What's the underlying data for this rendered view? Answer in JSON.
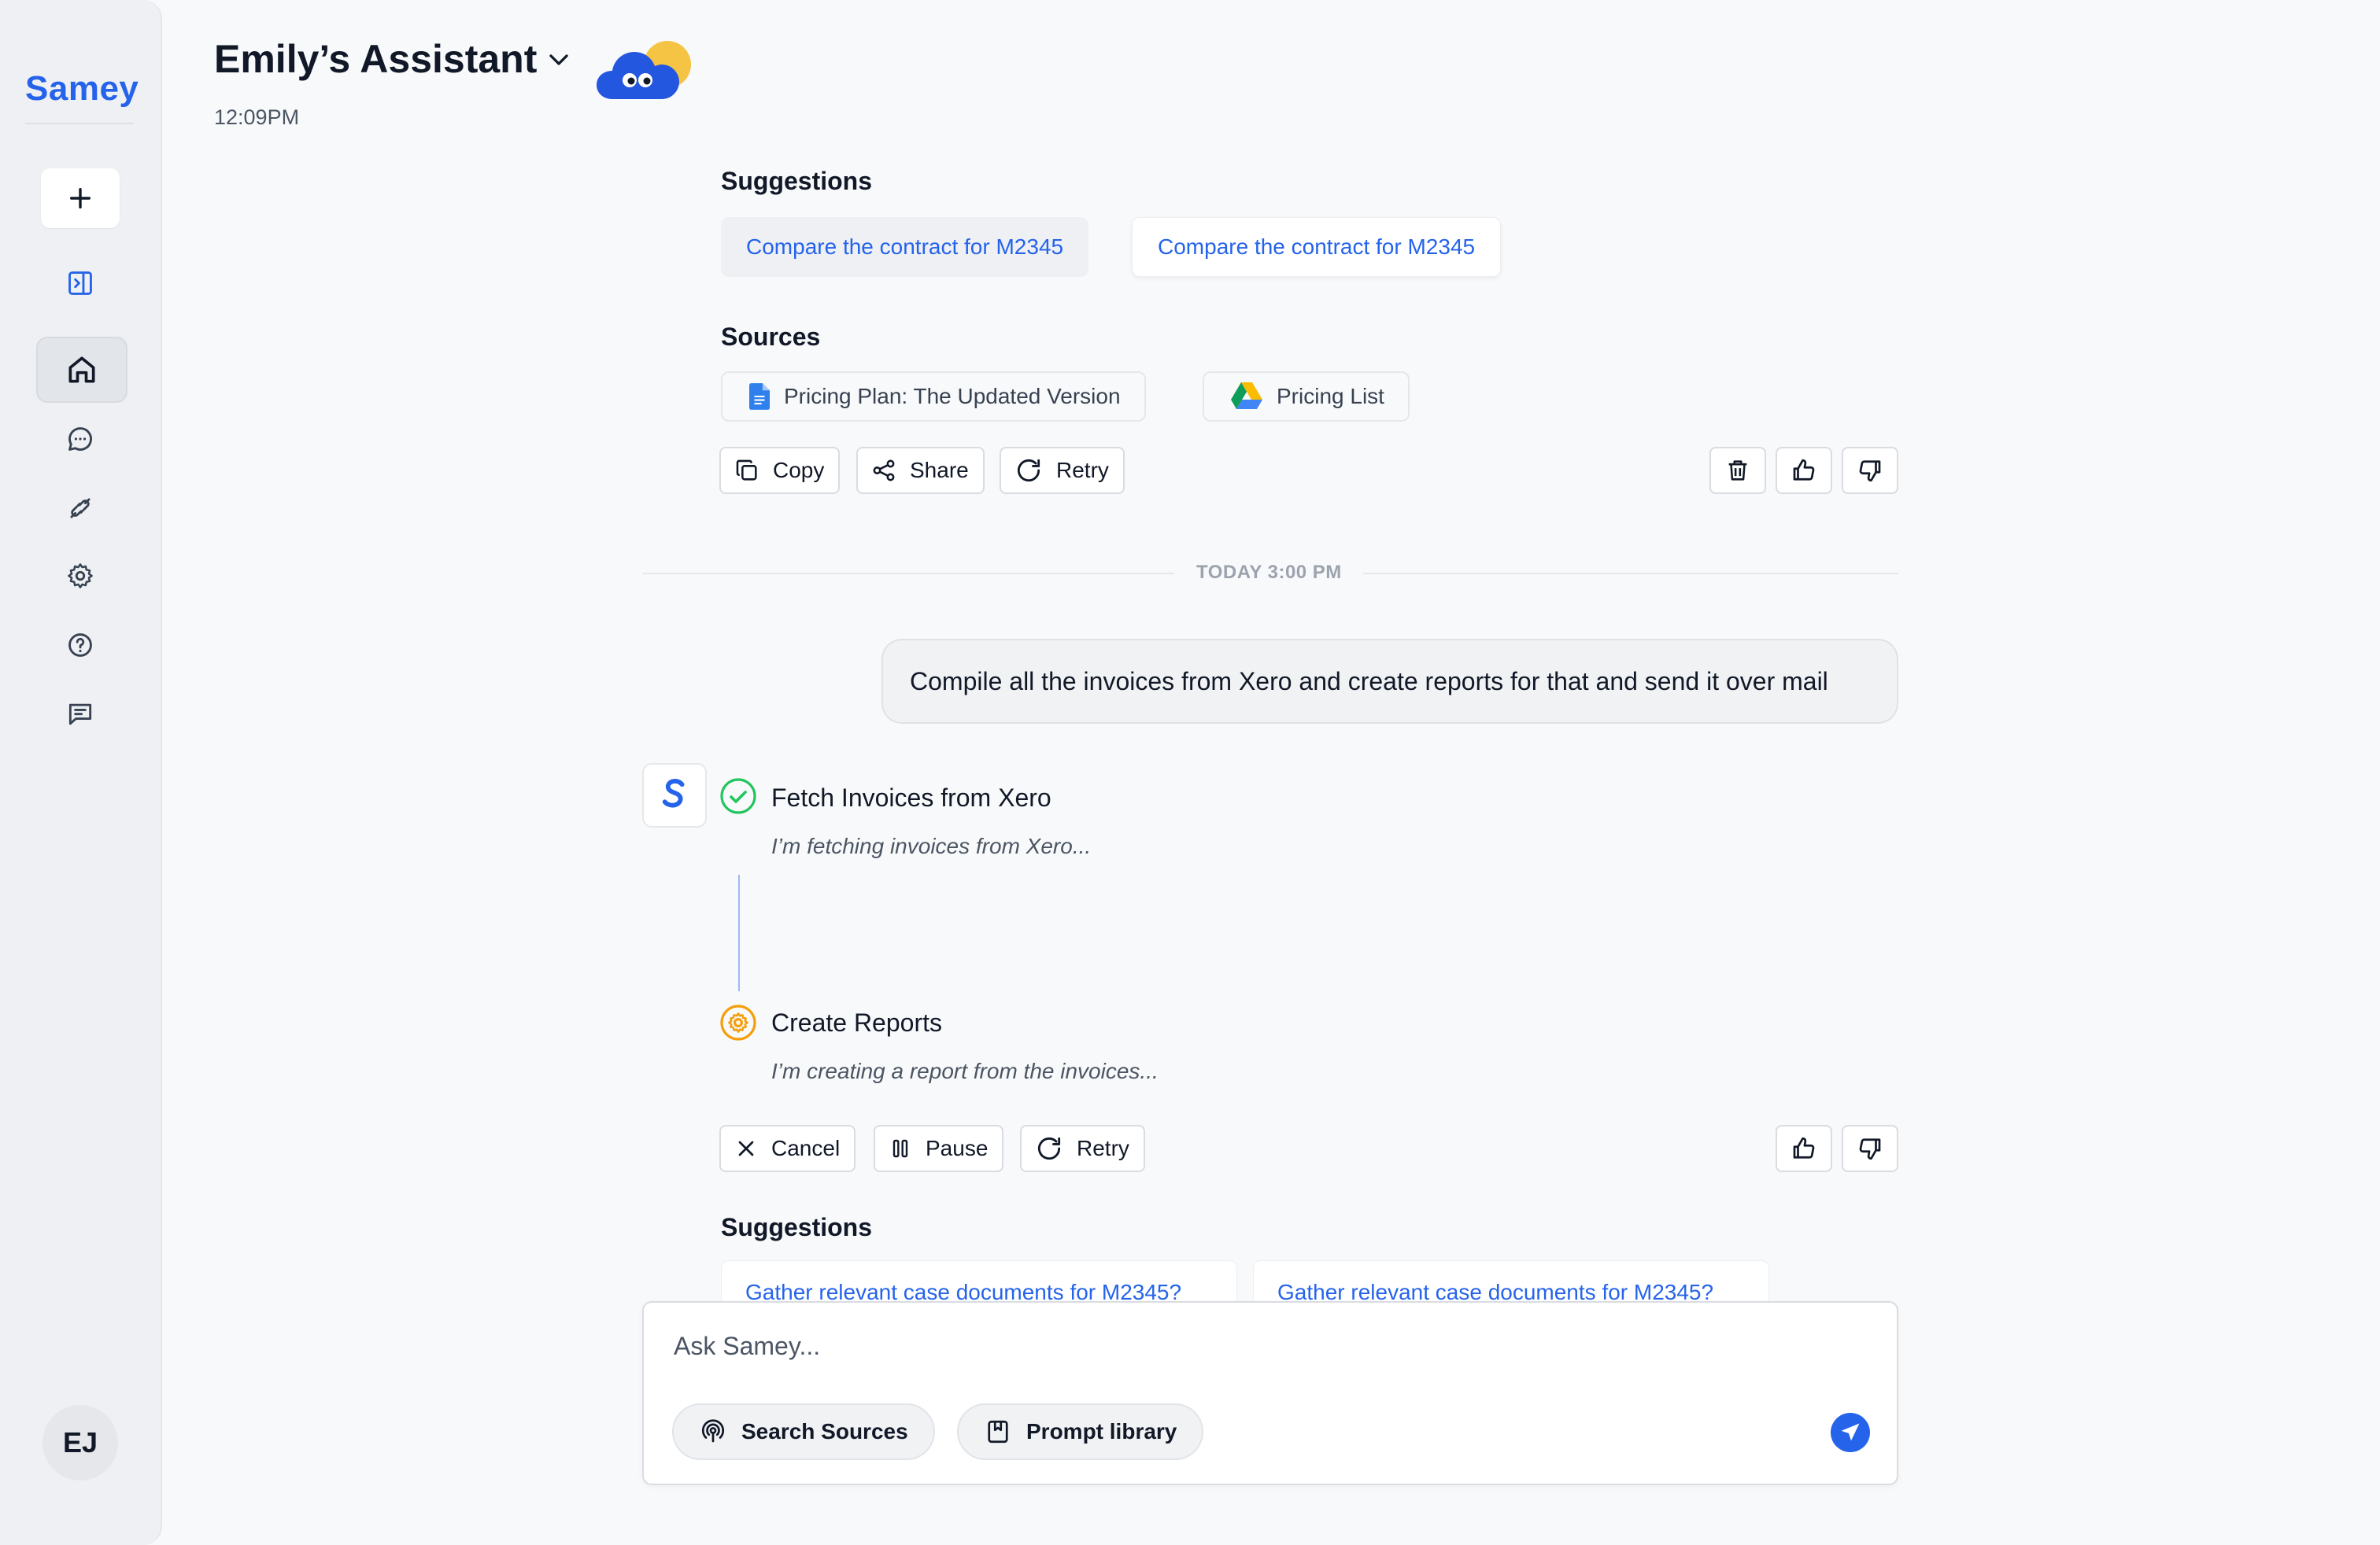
{
  "sidebar": {
    "logo": "Samey",
    "avatar_initials": "EJ",
    "icons": [
      "plus-icon",
      "sidebar-toggle-icon",
      "home-icon",
      "chat-icon",
      "integrations-icon",
      "settings-icon",
      "help-icon",
      "feedback-icon"
    ]
  },
  "header": {
    "title": "Emily’s Assistant",
    "time": "12:09PM"
  },
  "top_section": {
    "suggestions_label": "Suggestions",
    "suggestions": [
      "Compare the contract for M2345",
      "Compare the contract for M2345"
    ],
    "sources_label": "Sources",
    "sources": [
      "Pricing Plan: The Updated Version",
      "Pricing List"
    ],
    "actions": {
      "copy": "Copy",
      "share": "Share",
      "retry": "Retry"
    }
  },
  "divider": {
    "text": "TODAY 3:00 PM"
  },
  "user_message": "Compile all the invoices from Xero and create reports for that and send it over mail",
  "steps": [
    {
      "title": "Fetch Invoices from Xero",
      "desc": "I’m fetching invoices from Xero...",
      "status": "done"
    },
    {
      "title": "Create Reports",
      "desc": "I’m creating a report from the invoices...",
      "status": "in-progress"
    }
  ],
  "step_actions": {
    "cancel": "Cancel",
    "pause": "Pause",
    "retry": "Retry"
  },
  "bottom_section": {
    "suggestions_label": "Suggestions",
    "suggestions": [
      "Gather relevant case documents for M2345?",
      "Gather relevant case documents for M2345?"
    ]
  },
  "composer": {
    "placeholder": "Ask Samey...",
    "search_sources": "Search Sources",
    "prompt_library": "Prompt library"
  },
  "colors": {
    "accent": "#2563eb",
    "success": "#22c55e",
    "warning": "#f59e0b"
  }
}
